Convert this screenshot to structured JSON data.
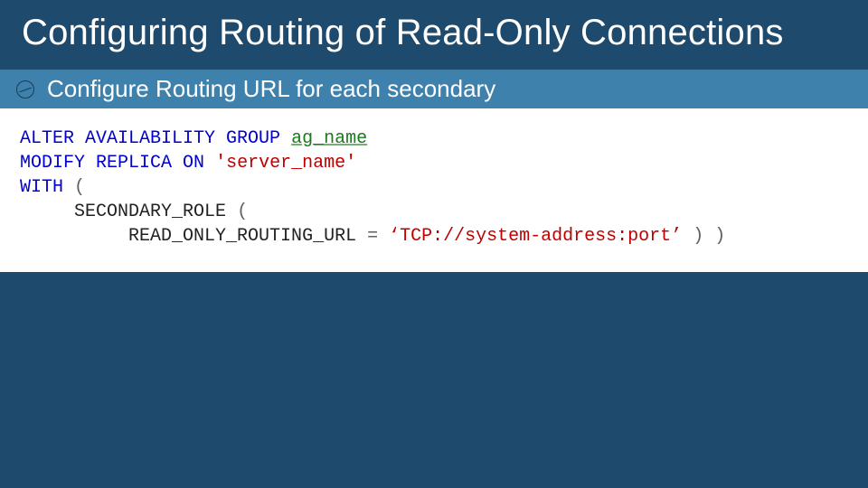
{
  "title": "Configuring Routing of Read-Only Connections",
  "subheading": "Configure Routing URL for each secondary",
  "code": {
    "kw_alter": "ALTER AVAILABILITY GROUP",
    "ag_name": "ag_name",
    "kw_modify": "MODIFY REPLICA ON",
    "server_literal": "'server_name'",
    "kw_with": "WITH",
    "paren_open1": "(",
    "secondary_role": "SECONDARY_ROLE",
    "paren_open2": "(",
    "routing_url": "READ_ONLY_ROUTING_URL",
    "eq": "=",
    "url_literal": "‘TCP://system-address:port’",
    "paren_close1": ")",
    "paren_close2": ")"
  }
}
